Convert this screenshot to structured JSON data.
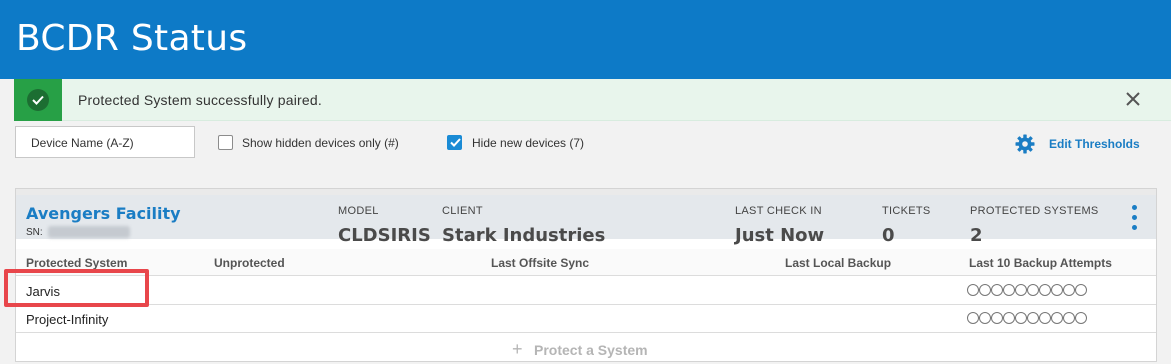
{
  "header": {
    "title": "BCDR Status"
  },
  "toast": {
    "message": "Protected System successfully paired.",
    "status_icon": "check-circle-icon",
    "close_icon": "close-icon",
    "color": "#27a046"
  },
  "filters": {
    "sort_value": "Device Name (A-Z)",
    "show_hidden_label": "Show hidden devices only (#)",
    "show_hidden_checked": false,
    "hide_new_label": "Hide new devices (7)",
    "hide_new_checked": true,
    "edit_thresholds_label": "Edit Thresholds",
    "edit_thresholds_icon": "gear-icon"
  },
  "device": {
    "facility": "Avengers Facility",
    "sn_label": "SN:",
    "model_label": "MODEL",
    "model_value": "CLDSIRIS",
    "client_label": "CLIENT",
    "client_value": "Stark Industries",
    "checkin_label": "LAST CHECK IN",
    "checkin_value": "Just Now",
    "tickets_label": "TICKETS",
    "tickets_value": "0",
    "protected_label": "PROTECTED SYSTEMS",
    "protected_value": "2",
    "menu_icon": "kebab-icon"
  },
  "table": {
    "headers": {
      "protected_system": "Protected System",
      "unprotected": "Unprotected",
      "last_offsite_sync": "Last Offsite Sync",
      "last_local_backup": "Last Local Backup",
      "last_10_attempts": "Last 10 Backup Attempts"
    },
    "rows": [
      {
        "name": "Jarvis",
        "attempts": 10
      },
      {
        "name": "Project-Infinity",
        "attempts": 10
      }
    ],
    "protect_label": "Protect a System",
    "protect_icon": "plus-icon"
  },
  "colors": {
    "header_blue": "#0d7ac7",
    "link_blue": "#1a7dc4",
    "highlight_red": "#e8464b"
  }
}
